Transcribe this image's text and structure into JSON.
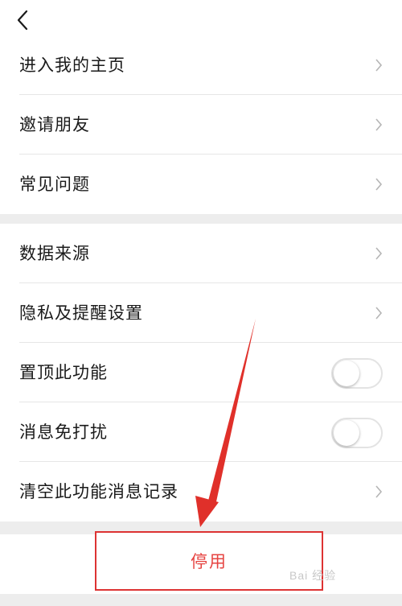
{
  "topbar": {
    "back_icon": "chevron-left-icon"
  },
  "group1": [
    {
      "label": "进入我的主页"
    },
    {
      "label": "邀请朋友"
    },
    {
      "label": "常见问题"
    }
  ],
  "group2": [
    {
      "label": "数据来源",
      "control": "chevron"
    },
    {
      "label": "隐私及提醒设置",
      "control": "chevron"
    },
    {
      "label": "置顶此功能",
      "control": "toggle",
      "on": false
    },
    {
      "label": "消息免打扰",
      "control": "toggle",
      "on": false
    },
    {
      "label": "清空此功能消息记录",
      "control": "chevron"
    }
  ],
  "stop_button": {
    "label": "停用",
    "color": "#e64340"
  },
  "watermark": {
    "text": "Bai 经验"
  },
  "colors": {
    "annotation_red": "#e0302a",
    "background": "#ededed"
  }
}
